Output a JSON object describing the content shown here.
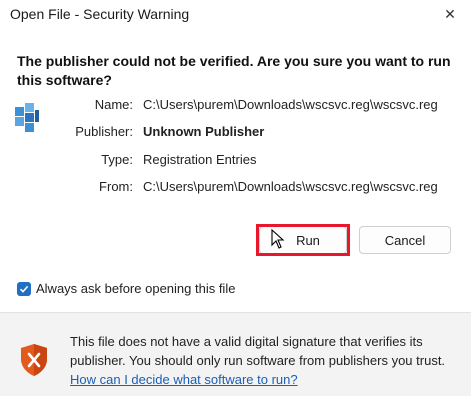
{
  "dialog": {
    "title": "Open File - Security Warning",
    "close_glyph": "✕",
    "question": "The publisher could not be verified.  Are you sure you want to run this software?"
  },
  "file": {
    "icon": "registry-file-icon",
    "name_label": "Name:",
    "name_value": "C:\\Users\\purem\\Downloads\\wscsvc.reg\\wscsvc.reg",
    "publisher_label": "Publisher:",
    "publisher_value": "Unknown Publisher",
    "type_label": "Type:",
    "type_value": "Registration Entries",
    "from_label": "From:",
    "from_value": "C:\\Users\\purem\\Downloads\\wscsvc.reg\\wscsvc.reg"
  },
  "buttons": {
    "run_label": "Run",
    "cancel_label": "Cancel"
  },
  "options": {
    "always_ask_label": "Always ask before opening this file",
    "always_ask_checked": true
  },
  "footer": {
    "warning_text": "This file does not have a valid digital signature that verifies its publisher.  You should only run software from publishers you trust.",
    "help_link": "How can I decide what software to run?",
    "shield_icon": "shield-warning-icon"
  },
  "colors": {
    "highlight": "#e8182a",
    "link": "#1a5fb4",
    "checkbox": "#1f6fc4",
    "shield": "#e25a1c"
  }
}
